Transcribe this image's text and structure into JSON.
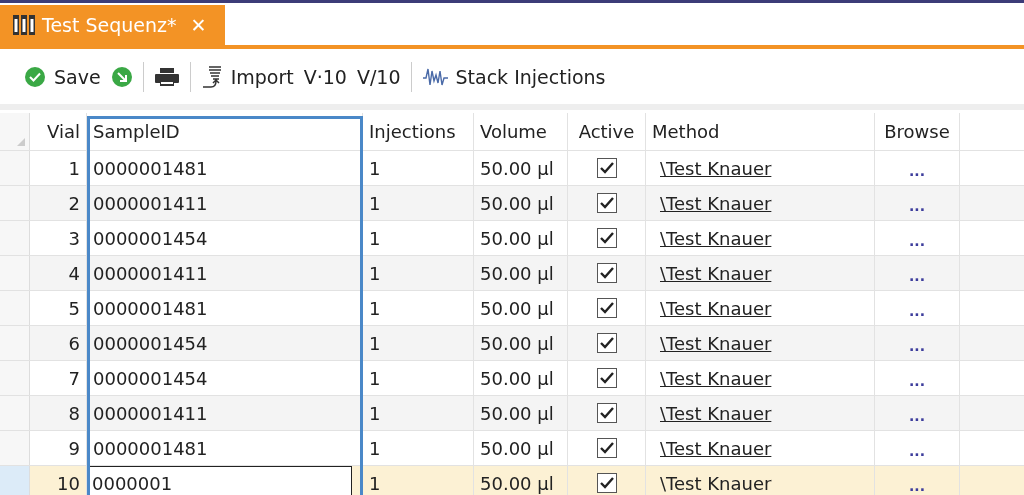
{
  "tab": {
    "title": "Test Sequenz*",
    "close": "✕"
  },
  "toolbar": {
    "save": "Save",
    "import": "Import",
    "v_dot": "V·10",
    "v_slash": "V/10",
    "stack": "Stack Injections"
  },
  "table": {
    "columns": [
      "Vial",
      "SampleID",
      "Injections",
      "Volume",
      "Active",
      "Method",
      "Browse"
    ],
    "rows": [
      {
        "vial": "1",
        "sample_id": "0000001481",
        "injections": "1",
        "volume": "50.00 µl",
        "active": true,
        "method": "\\Test Knauer",
        "browse": "...",
        "selected": false
      },
      {
        "vial": "2",
        "sample_id": "0000001411",
        "injections": "1",
        "volume": "50.00 µl",
        "active": true,
        "method": "\\Test Knauer",
        "browse": "...",
        "selected": false
      },
      {
        "vial": "3",
        "sample_id": "0000001454",
        "injections": "1",
        "volume": "50.00 µl",
        "active": true,
        "method": "\\Test Knauer",
        "browse": "...",
        "selected": false
      },
      {
        "vial": "4",
        "sample_id": "0000001411",
        "injections": "1",
        "volume": "50.00 µl",
        "active": true,
        "method": "\\Test Knauer",
        "browse": "...",
        "selected": false
      },
      {
        "vial": "5",
        "sample_id": "0000001481",
        "injections": "1",
        "volume": "50.00 µl",
        "active": true,
        "method": "\\Test Knauer",
        "browse": "...",
        "selected": false
      },
      {
        "vial": "6",
        "sample_id": "0000001454",
        "injections": "1",
        "volume": "50.00 µl",
        "active": true,
        "method": "\\Test Knauer",
        "browse": "...",
        "selected": false
      },
      {
        "vial": "7",
        "sample_id": "0000001454",
        "injections": "1",
        "volume": "50.00 µl",
        "active": true,
        "method": "\\Test Knauer",
        "browse": "...",
        "selected": false
      },
      {
        "vial": "8",
        "sample_id": "0000001411",
        "injections": "1",
        "volume": "50.00 µl",
        "active": true,
        "method": "\\Test Knauer",
        "browse": "...",
        "selected": false
      },
      {
        "vial": "9",
        "sample_id": "0000001481",
        "injections": "1",
        "volume": "50.00 µl",
        "active": true,
        "method": "\\Test Knauer",
        "browse": "...",
        "selected": false
      },
      {
        "vial": "10",
        "sample_id": "0000001",
        "injections": "1",
        "volume": "50.00 µl",
        "active": true,
        "method": "\\Test Knauer",
        "browse": "...",
        "selected": true
      }
    ]
  }
}
